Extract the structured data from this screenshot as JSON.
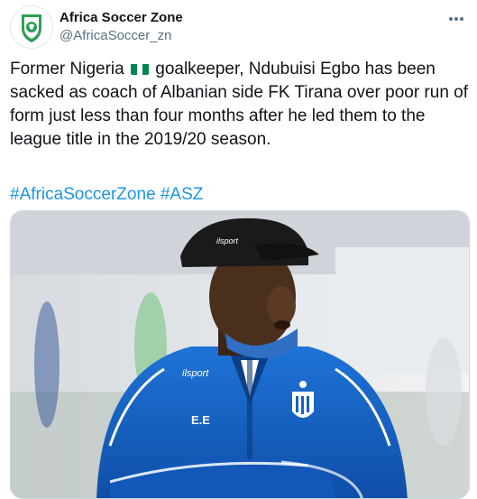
{
  "author": {
    "display_name": "Africa Soccer Zone",
    "handle": "@AfricaSoccer_zn"
  },
  "tweet": {
    "text_before_flag": "Former Nigeria",
    "text_after_flag": " goalkeeper, Ndubuisi Egbo has been sacked as coach of Albanian side FK Tirana over poor run of form just less than four months after he led them to the league title in the 2019/20 season.",
    "hashtags": [
      "#AfricaSoccerZone",
      "#ASZ"
    ]
  },
  "media": {
    "jacket_initials": "E.E",
    "cap_brand": "ilsport",
    "jacket_brand": "ilsport"
  },
  "icons": {
    "avatar": "africa-soccer-zone-logo-icon",
    "more": "more-options-icon",
    "flag": "nigeria-flag-icon"
  },
  "colors": {
    "hashtag": "#1b95e0",
    "secondary_text": "#5b7083",
    "flag_green": "#008751",
    "jacket_blue": "#1560c4"
  }
}
